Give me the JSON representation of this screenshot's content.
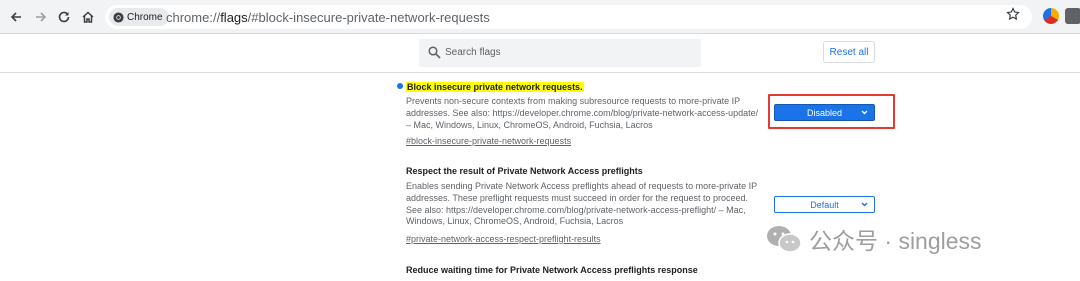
{
  "browser": {
    "chip_label": "Chrome",
    "url_scheme": "chrome://",
    "url_host": "flags",
    "url_path": "/#block-insecure-private-network-requests",
    "icons": [
      "back-icon",
      "forward-icon",
      "reload-icon",
      "home-icon",
      "star-icon"
    ]
  },
  "toolbar": {
    "search_placeholder": "Search flags",
    "reset_label": "Reset all"
  },
  "flags": [
    {
      "title": "Block insecure private network requests.",
      "description": "Prevents non-secure contexts from making subresource requests to more-private IP addresses. See also: https://developer.chrome.com/blog/private-network-access-update/ – Mac, Windows, Linux, ChromeOS, Android, Fuchsia, Lacros",
      "link": "#block-insecure-private-network-requests",
      "value": "Disabled"
    },
    {
      "title": "Respect the result of Private Network Access preflights",
      "description": "Enables sending Private Network Access preflights ahead of requests to more-private IP addresses. These preflight requests must succeed in order for the request to proceed. See also: https://developer.chrome.com/blog/private-network-access-preflight/ – Mac, Windows, Linux, ChromeOS, Android, Fuchsia, Lacros",
      "link": "#private-network-access-respect-preflight-results",
      "value": "Default"
    },
    {
      "title": "Reduce waiting time for Private Network Access preflights response"
    }
  ],
  "watermark": {
    "text": "公众号 · singless"
  },
  "colors": {
    "accent": "#1a73e8",
    "highlight": "#ffff00",
    "annotation": "#e53935"
  }
}
